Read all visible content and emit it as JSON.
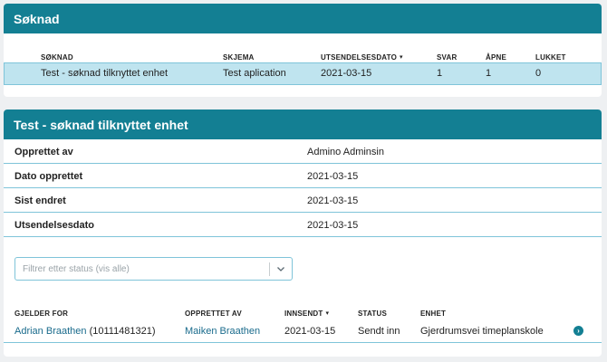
{
  "soknad_panel": {
    "title": "Søknad",
    "columns": [
      "SØKNAD",
      "SKJEMA",
      "UTSENDELSESDATO",
      "SVAR",
      "ÅPNE",
      "LUKKET"
    ],
    "sort_indicator": "▾",
    "row": {
      "soknad": "Test - søknad tilknyttet enhet",
      "skjema": "Test aplication",
      "utsendelsesdato": "2021-03-15",
      "svar": "1",
      "apne": "1",
      "lukket": "0"
    }
  },
  "detail_panel": {
    "title": "Test - søknad tilknyttet enhet",
    "fields": [
      {
        "label": "Opprettet av",
        "value": "Admino Adminsin"
      },
      {
        "label": "Dato opprettet",
        "value": "2021-03-15"
      },
      {
        "label": "Sist endret",
        "value": "2021-03-15"
      },
      {
        "label": "Utsendelsesdato",
        "value": "2021-03-15"
      }
    ],
    "filter": {
      "placeholder": "Filtrer etter status (vis alle)"
    },
    "columns": [
      "GJELDER FOR",
      "OPPRETTET AV",
      "INNSENDT",
      "STATUS",
      "ENHET"
    ],
    "sort_indicator": "▾",
    "row": {
      "gjelder_for_name": "Adrian Braathen",
      "gjelder_for_id": "(10111481321)",
      "opprettet_av": "Maiken Braathen",
      "innsendt": "2021-03-15",
      "status": "Sendt inn",
      "enhet": "Gjerdrumsvei timeplanskole"
    },
    "open_icon_glyph": "›"
  },
  "colors": {
    "header_bg": "#137f93",
    "selected_row_bg": "#bfe4ef",
    "divider": "#7fc4d9",
    "link": "#1a6b8c"
  }
}
